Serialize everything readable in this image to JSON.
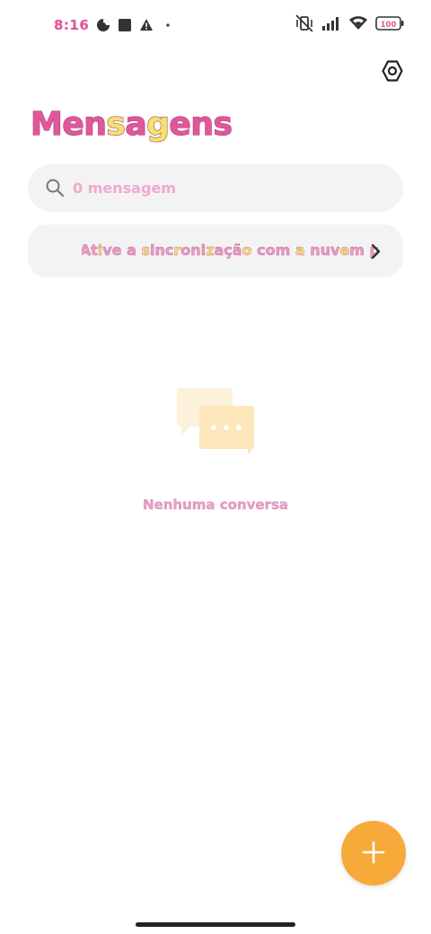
{
  "status_bar": {
    "time": "8:16",
    "battery": "100",
    "icons_left": [
      "data-saver-icon",
      "square-notification-icon",
      "warning-icon",
      "dot-icon"
    ],
    "icons_right": [
      "vibrate-off-icon",
      "signal-icon",
      "wifi-icon",
      "battery-icon"
    ]
  },
  "header": {
    "title": "Mensagens",
    "settings_icon": "settings-hexagon-icon"
  },
  "search": {
    "placeholder": "0 mensagem",
    "icon": "search-icon"
  },
  "sync_banner": {
    "text": "Ative a sincronização com a nuvem p",
    "chevron_icon": "chevron-right-icon"
  },
  "empty_state": {
    "illustration": "chat-bubbles-icon",
    "text": "Nenhuma conversa"
  },
  "fab": {
    "icon": "plus-icon"
  },
  "colors": {
    "accent": "#f7a93a",
    "pink": "#e0579a",
    "yellow": "#f3e36a",
    "surface": "#f3f3f3"
  }
}
